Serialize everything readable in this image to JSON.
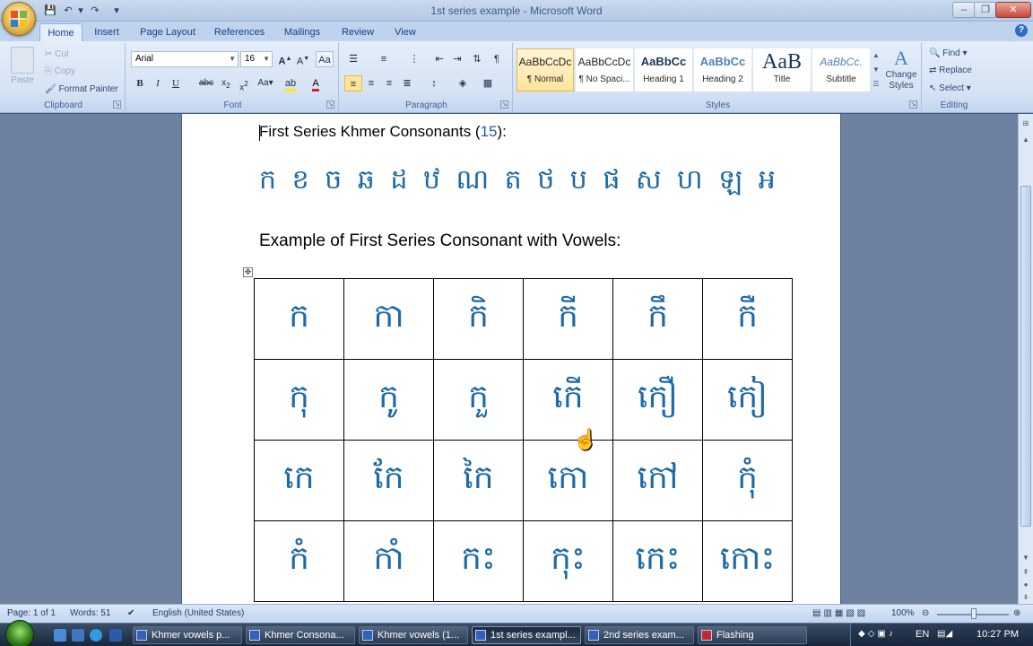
{
  "window": {
    "title": "1st series example - Microsoft Word"
  },
  "ribbon_tabs": [
    "Home",
    "Insert",
    "Page Layout",
    "References",
    "Mailings",
    "Review",
    "View"
  ],
  "clipboard": {
    "paste": "Paste",
    "cut": "Cut",
    "copy": "Copy",
    "format_painter": "Format Painter",
    "label": "Clipboard"
  },
  "font": {
    "name": "Arial",
    "size": "16",
    "label": "Font"
  },
  "paragraph": {
    "label": "Paragraph"
  },
  "styles": {
    "items": [
      {
        "sample": "AaBbCcDc",
        "name": "¶ Normal"
      },
      {
        "sample": "AaBbCcDc",
        "name": "¶ No Spaci..."
      },
      {
        "sample": "AaBbCc",
        "name": "Heading 1"
      },
      {
        "sample": "AaBbCc",
        "name": "Heading 2"
      },
      {
        "sample": "AaB",
        "name": "Title"
      },
      {
        "sample": "AaBbCc.",
        "name": "Subtitle"
      }
    ],
    "change_styles": "Change Styles",
    "label": "Styles"
  },
  "editing": {
    "find": "Find",
    "replace": "Replace",
    "select": "Select",
    "label": "Editing"
  },
  "document": {
    "heading1_text": "First Series Khmer Consonants (",
    "heading1_num": "15",
    "heading1_end": "):",
    "consonants": "ក ខ ច ឆ ដ ឋ ណ ត ថ ប ផ ស ហ ឡ អ",
    "heading2": "Example of First Series Consonant with Vowels:",
    "table": [
      [
        "ក",
        "កា",
        "កិ",
        "កី",
        "កឹ",
        "កឺ"
      ],
      [
        "កុ",
        "កូ",
        "កួ",
        "កើ",
        "កឿ",
        "កៀ"
      ],
      [
        "កេ",
        "កែ",
        "កៃ",
        "កោ",
        "កៅ",
        "កុំ"
      ],
      [
        "កំ",
        "កាំ",
        "កះ",
        "កុះ",
        "កេះ",
        "កោះ"
      ]
    ]
  },
  "statusbar": {
    "page": "Page: 1 of 1",
    "words": "Words: 51",
    "language": "English (United States)",
    "zoom": "100%",
    "zoom_level": 1.0
  },
  "taskbar": {
    "buttons": [
      "Khmer vowels p...",
      "Khmer Consona...",
      "Khmer vowels (1...",
      "1st series exampl...",
      "2nd series exam...",
      "Flashing"
    ],
    "active_index": 3,
    "lang": "EN",
    "time": "10:27 PM"
  }
}
